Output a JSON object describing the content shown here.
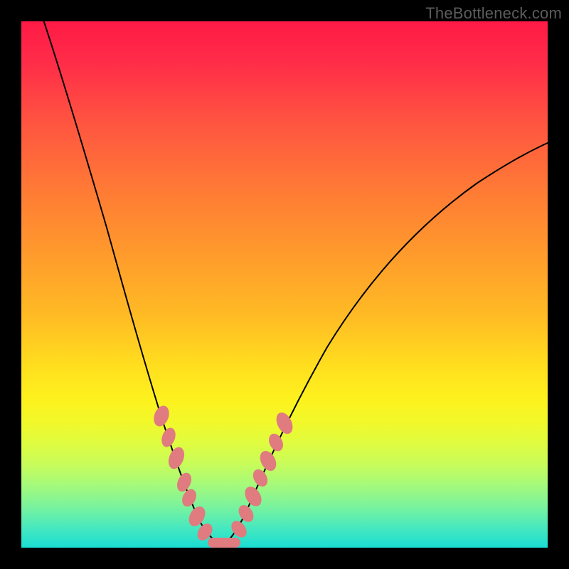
{
  "watermark": "TheBottleneck.com",
  "colors": {
    "background": "#000000",
    "curve": "#000000",
    "marker": "#e07b7f",
    "gradient_top": "#ff1a46",
    "gradient_bottom": "#1addd4"
  },
  "chart_data": {
    "type": "line",
    "title": "",
    "xlabel": "",
    "ylabel": "",
    "xlim": [
      0,
      100
    ],
    "ylim": [
      0,
      100
    ],
    "grid": false,
    "legend": false,
    "series": [
      {
        "name": "left-curve",
        "x": [
          0,
          4,
          8,
          12,
          16,
          20,
          23,
          26,
          29,
          31,
          33.5,
          36
        ],
        "values": [
          100,
          87,
          73,
          59,
          46,
          33,
          23,
          14.5,
          8,
          4.5,
          2,
          0.5
        ]
      },
      {
        "name": "right-curve",
        "x": [
          36,
          39,
          42,
          46,
          52,
          60,
          70,
          82,
          94,
          100
        ],
        "values": [
          0.5,
          4,
          10,
          19,
          32,
          46,
          58,
          67,
          73,
          76
        ]
      }
    ],
    "annotations": [
      {
        "name": "marker-cluster-left",
        "x_range": [
          22,
          34
        ],
        "shape": "dashed-capsules"
      },
      {
        "name": "marker-cluster-right",
        "x_range": [
          37,
          46
        ],
        "shape": "dashed-capsules"
      },
      {
        "name": "marker-bottom",
        "x_range": [
          33,
          40
        ],
        "shape": "horizontal-capsule"
      }
    ]
  }
}
